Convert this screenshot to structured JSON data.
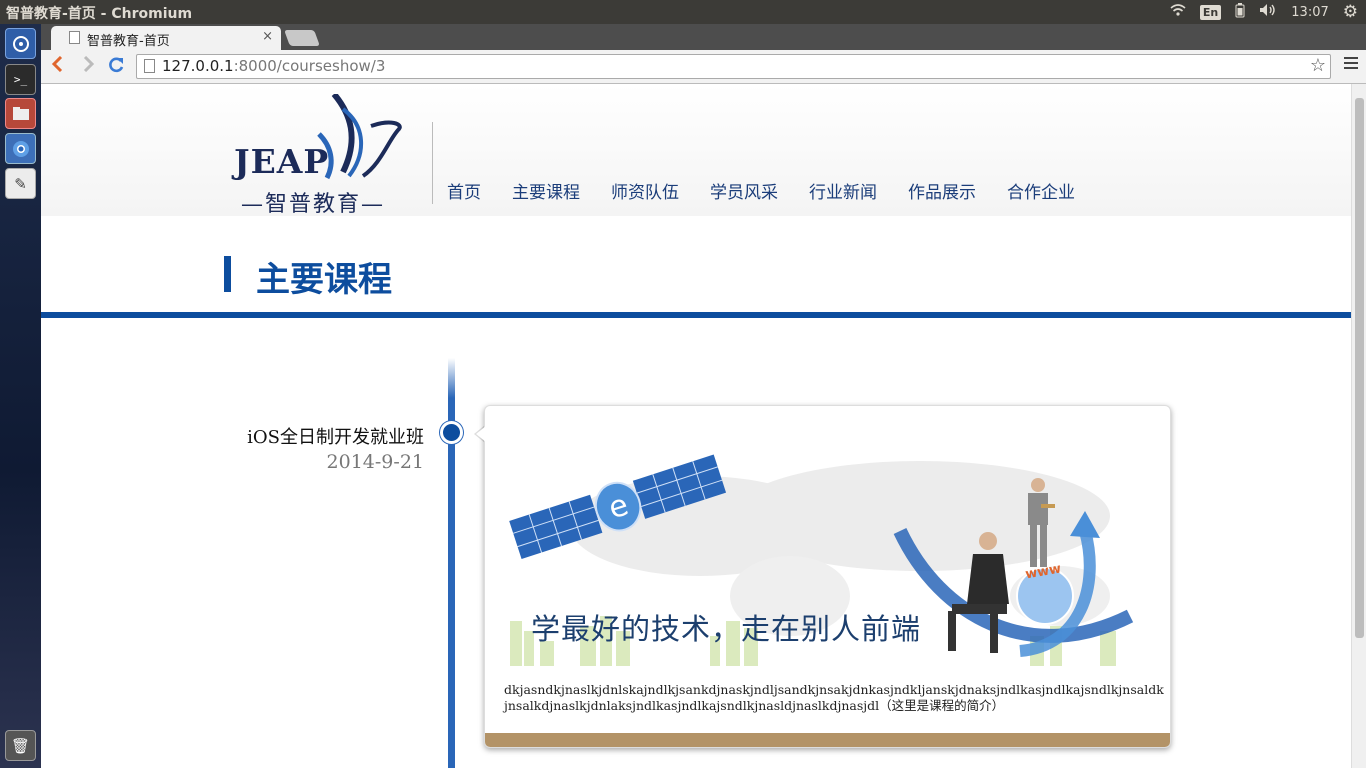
{
  "os": {
    "window_title": "智普教育-首页 - Chromium",
    "keyboard": "En",
    "clock": "13:07"
  },
  "browser": {
    "tab_title": "智普教育-首页",
    "tab_close": "×",
    "url_host": "127.0.0.1",
    "url_rest": ":8000/courseshow/3"
  },
  "site": {
    "logo_text": "JEAP",
    "logo_cn": "—智普教育—",
    "nav": [
      "首页",
      "主要课程",
      "师资队伍",
      "学员风采",
      "行业新闻",
      "作品展示",
      "合作企业"
    ]
  },
  "section": {
    "title": "主要课程"
  },
  "course": {
    "title": "iOS全日制开发就业班",
    "date": "2014-9-21",
    "banner_slogan": "学最好的技术，走在别人前端",
    "banner_badge": "www",
    "description": "dkjasndkjnaslkjdnlskajndlkjsankdjnaskjndljsandkjnsakjdnkasjndkljanskjdnaksjndlkasjndlkajsndlkjnsaldkjnsalkdjnaslkjdnlaksjndlkasjndlkajsndlkjnasldjnaslkdjnasjdl（这里是课程的简介）"
  },
  "colors": {
    "brand_blue": "#0d4d9e",
    "card_footer": "#b39367"
  }
}
